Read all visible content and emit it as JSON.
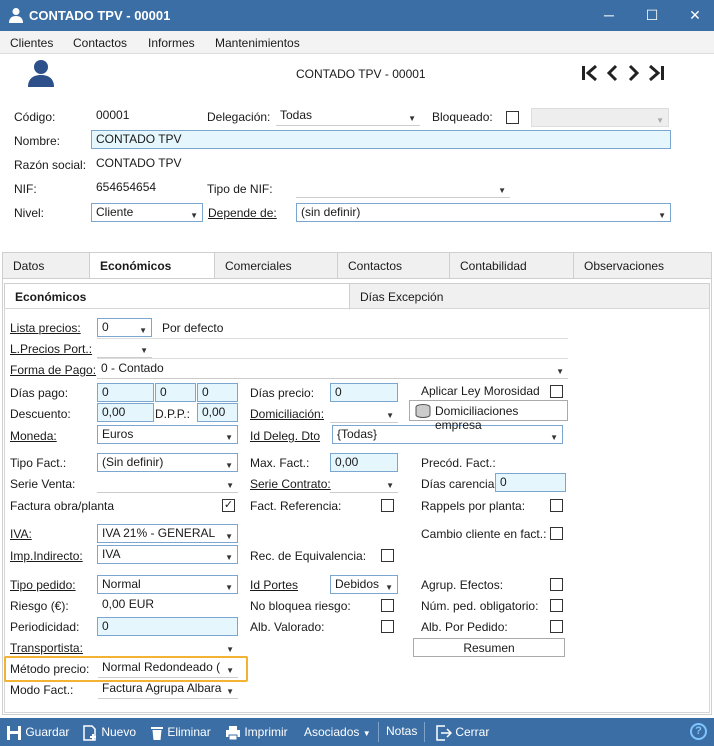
{
  "window": {
    "title": "CONTADO TPV - 00001"
  },
  "menu": [
    "Clientes",
    "Contactos",
    "Informes",
    "Mantenimientos"
  ],
  "header": {
    "center_title": "CONTADO TPV - 00001"
  },
  "form": {
    "codigo_label": "Código:",
    "codigo": "00001",
    "delegacion_label": "Delegación:",
    "delegacion": "Todas",
    "bloqueado_label": "Bloqueado:",
    "nombre_label": "Nombre:",
    "nombre": "CONTADO TPV",
    "razon_label": "Razón social:",
    "razon": "CONTADO TPV",
    "nif_label": "NIF:",
    "nif": "654654654",
    "tiponif_label": "Tipo de NIF:",
    "tiponif": "",
    "nivel_label": "Nivel:",
    "nivel": "Cliente",
    "depende_label": "Depende de:",
    "depende": "(sin definir)"
  },
  "tabs": [
    "Datos",
    "Económicos",
    "Comerciales",
    "Contactos",
    "Contabilidad",
    "Observaciones"
  ],
  "subtabs": [
    "Económicos",
    "Días Excepción"
  ],
  "eco": {
    "lista_precios_label": "Lista precios:",
    "lista_precios": "0",
    "lista_precios_desc": "Por defecto",
    "lprecios_port_label": "L.Precios Port.:",
    "forma_pago_label": "Forma de Pago:",
    "forma_pago": "0 - Contado",
    "dias_pago_label": "Días pago:",
    "dias_pago": [
      "0",
      "0",
      "0"
    ],
    "dias_precio_label": "Días precio:",
    "dias_precio": "0",
    "aplicar_ley_label": "Aplicar Ley Morosidad",
    "descuento_label": "Descuento:",
    "descuento": "0,00",
    "dpp_label": "D.P.P.:",
    "dpp": "0,00",
    "domiciliacion_label": "Domiciliación:",
    "domiciliaciones_btn": "Domiciliaciones empresa",
    "moneda_label": "Moneda:",
    "moneda": "Euros",
    "id_deleg_label": "Id Deleg. Dto",
    "id_deleg": "{Todas}",
    "tipo_fact_label": "Tipo Fact.:",
    "tipo_fact": "(Sin definir)",
    "max_fact_label": "Max. Fact.:",
    "max_fact": "0,00",
    "precod_fact_label": "Precód. Fact.:",
    "serie_venta_label": "Serie Venta:",
    "serie_contrato_label": "Serie Contrato:",
    "dias_carencia_label": "Días carencia:",
    "dias_carencia": "0",
    "factura_obra_label": "Factura obra/planta",
    "fact_ref_label": "Fact. Referencia:",
    "rappels_label": "Rappels por planta:",
    "iva_label": "IVA:",
    "iva": "IVA 21% - GENERAL",
    "cambio_cliente_label": "Cambio cliente en fact.:",
    "imp_indirecto_label": "Imp.Indirecto:",
    "imp_indirecto": "IVA",
    "rec_equiv_label": "Rec. de Equivalencia:",
    "tipo_pedido_label": "Tipo pedido:",
    "tipo_pedido": "Normal",
    "id_portes_label": "Id Portes",
    "id_portes": "Debidos",
    "agrup_efectos_label": "Agrup. Efectos:",
    "riesgo_label": "Riesgo (€):",
    "riesgo": "0,00 EUR",
    "no_bloquea_label": "No bloquea riesgo:",
    "num_ped_label": "Núm. ped. obligatorio:",
    "periodicidad_label": "Periodicidad:",
    "periodicidad": "0",
    "alb_valorado_label": "Alb. Valorado:",
    "alb_pedido_label": "Alb. Por Pedido:",
    "transportista_label": "Transportista:",
    "resumen_btn": "Resumen",
    "metodo_precio_label": "Método precio:",
    "metodo_precio": "Normal Redondeado (",
    "modo_fact_label": "Modo Fact.:",
    "modo_fact": "Factura Agrupa Albara"
  },
  "toolbar": {
    "guardar": "Guardar",
    "nuevo": "Nuevo",
    "eliminar": "Eliminar",
    "imprimir": "Imprimir",
    "asociados": "Asociados",
    "notas": "Notas",
    "cerrar": "Cerrar"
  }
}
